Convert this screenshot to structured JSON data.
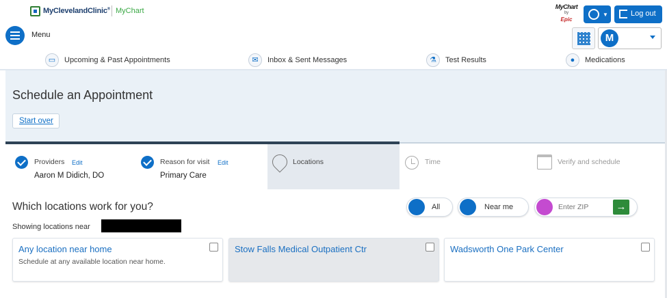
{
  "header": {
    "brand_name": "MyClevelandClinic",
    "brand_mark": "®",
    "brand_app": "MyChart",
    "menu_label": "Menu",
    "epic_logo": {
      "line1": "MyChart",
      "line2": "by",
      "line3": "Epic"
    },
    "logout_label": "Log out",
    "avatar_letter": "M",
    "nav": [
      {
        "label": "Upcoming & Past Appointments",
        "icon": "calendar-icon"
      },
      {
        "label": "Inbox & Sent Messages",
        "icon": "envelope-icon"
      },
      {
        "label": "Test Results",
        "icon": "flask-icon"
      },
      {
        "label": "Medications",
        "icon": "pills-icon"
      }
    ]
  },
  "page": {
    "title": "Schedule an Appointment",
    "start_over": "Start over"
  },
  "steps": [
    {
      "label": "Providers",
      "edit": "Edit",
      "value": "Aaron M Didich, DO",
      "state": "done"
    },
    {
      "label": "Reason for visit",
      "edit": "Edit",
      "value": "Primary Care",
      "state": "done"
    },
    {
      "label": "Locations",
      "state": "active"
    },
    {
      "label": "Time",
      "state": "upcoming"
    },
    {
      "label": "Verify and schedule",
      "state": "upcoming"
    }
  ],
  "locations": {
    "question": "Which locations work for you?",
    "showing_prefix": "Showing locations near",
    "filters": {
      "all": "All",
      "near_me": "Near me",
      "zip_placeholder": "Enter ZIP",
      "go": "→"
    },
    "cards": [
      {
        "title": "Any location near home",
        "subtitle": "Schedule at any available location near home.",
        "selected": false
      },
      {
        "title": "Stow Falls Medical Outpatient Ctr",
        "subtitle": "",
        "selected": false
      },
      {
        "title": "Wadsworth One Park Center",
        "subtitle": "",
        "selected": false
      }
    ]
  },
  "colors": {
    "primary": "#0e6fc7",
    "go_button": "#2e8b3a",
    "band": "#eaf1f7",
    "progress": "#2e4356"
  }
}
